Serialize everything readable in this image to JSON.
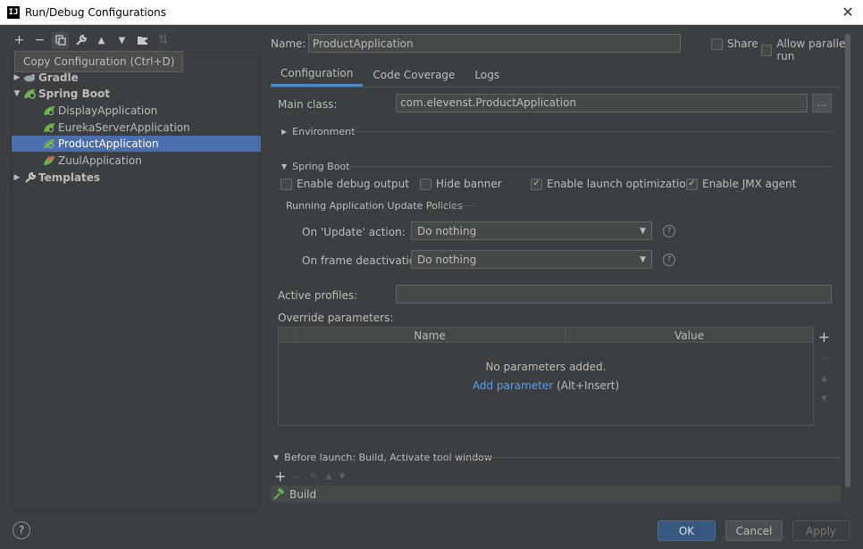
{
  "window": {
    "title": "Run/Debug Configurations",
    "app_icon_text": "IJ"
  },
  "toolbar": {
    "add": "+",
    "remove": "−",
    "copy": "⧉",
    "edit_defaults": "🔧",
    "move_up": "▲",
    "move_down": "▼",
    "new_folder": "▰",
    "sort": "⇅"
  },
  "tooltip": "Copy Configuration (Ctrl+D)",
  "tree": {
    "gradle": "Gradle",
    "spring_boot": "Spring Boot",
    "items": [
      {
        "label": "DisplayApplication"
      },
      {
        "label": "EurekaServerApplication"
      },
      {
        "label": "ProductApplication"
      },
      {
        "label": "ZuulApplication"
      }
    ],
    "templates": "Templates"
  },
  "name": {
    "label": "Name:",
    "value": "ProductApplication"
  },
  "share": {
    "label": "Share",
    "checked": false
  },
  "parallel": {
    "label": "Allow parallel run",
    "checked": false
  },
  "tabs": [
    "Configuration",
    "Code Coverage",
    "Logs"
  ],
  "main_class": {
    "label": "Main class:",
    "value": "com.elevenst.ProductApplication",
    "browse": "..."
  },
  "environment": {
    "label": "Environment"
  },
  "spring_boot_section": {
    "title": "Spring Boot",
    "debug_output": "Enable debug output",
    "hide_banner": "Hide banner",
    "launch_opt": "Enable launch optimization",
    "jmx_agent": "Enable JMX agent",
    "check_glyph": "✓",
    "policies_title": "Running Application Update Policies",
    "update_label": "On 'Update' action:",
    "update_value": "Do nothing",
    "frame_label": "On frame deactivation:",
    "frame_value": "Do nothing",
    "help_glyph": "?"
  },
  "active_profiles": {
    "label": "Active profiles:",
    "value": ""
  },
  "override": {
    "label": "Override parameters:",
    "col_name": "Name",
    "col_value": "Value",
    "empty_text": "No parameters added.",
    "add_link": "Add parameter",
    "add_hint": "(Alt+Insert)",
    "side_add": "+",
    "side_remove": "−",
    "side_up": "▲",
    "side_down": "▼"
  },
  "before_launch": {
    "title": "Before launch: Build, Activate tool window",
    "add": "+",
    "remove": "−",
    "edit": "✎",
    "up": "▲",
    "down": "▼",
    "item": "Build"
  },
  "footer": {
    "help": "?",
    "ok": "OK",
    "cancel": "Cancel",
    "apply": "Apply"
  }
}
